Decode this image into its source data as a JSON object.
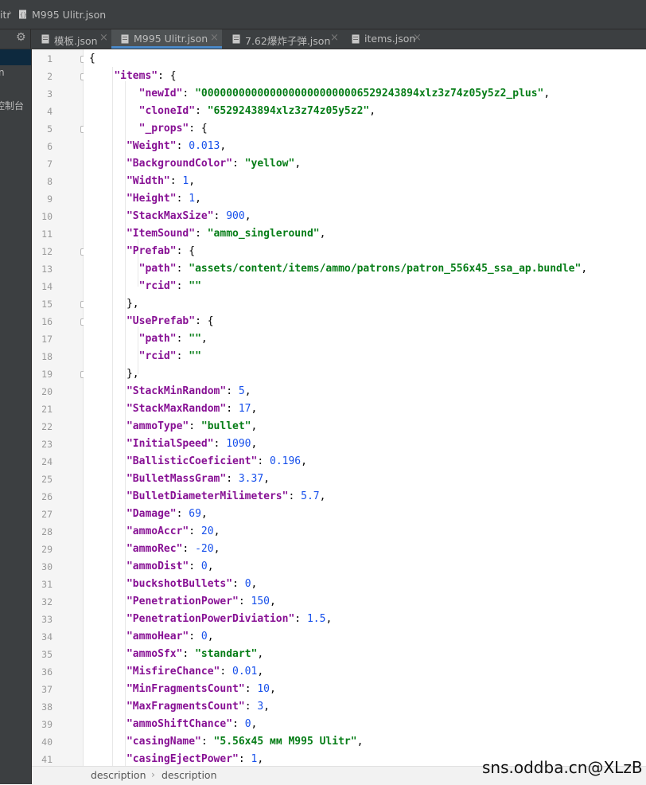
{
  "breadcrumb": {
    "project": "itr",
    "file": "M995 Ulitr.json"
  },
  "tabs": [
    {
      "label": "模板.json",
      "active": false
    },
    {
      "label": "M995 Ulitr.json",
      "active": true
    },
    {
      "label": "7.62爆炸子弹.json",
      "active": false
    },
    {
      "label": "items.json",
      "active": false
    }
  ],
  "side_panel": {
    "items": [
      "n",
      "控制台"
    ]
  },
  "editor": {
    "line_numbers": [
      "1",
      "2",
      "3",
      "4",
      "5",
      "6",
      "7",
      "8",
      "9",
      "10",
      "11",
      "12",
      "13",
      "14",
      "15",
      "16",
      "17",
      "18",
      "19",
      "20",
      "21",
      "22",
      "23",
      "24",
      "25",
      "26",
      "27",
      "28",
      "29",
      "30",
      "31",
      "32",
      "33",
      "34",
      "35",
      "36",
      "37",
      "38",
      "39",
      "40",
      "41"
    ],
    "lines": [
      "{",
      "    \"items\": {",
      "        \"newId\": \"00000000000000000000000006529243894xlz3z74z05y5z2_plus\",",
      "        \"cloneId\": \"6529243894xlz3z74z05y5z2\",",
      "        \"_props\": {",
      "      \"Weight\": 0.013,",
      "      \"BackgroundColor\": \"yellow\",",
      "      \"Width\": 1,",
      "      \"Height\": 1,",
      "      \"StackMaxSize\": 900,",
      "      \"ItemSound\": \"ammo_singleround\",",
      "      \"Prefab\": {",
      "        \"path\": \"assets/content/items/ammo/patrons/patron_556x45_ssa_ap.bundle\",",
      "        \"rcid\": \"\"",
      "      },",
      "      \"UsePrefab\": {",
      "        \"path\": \"\",",
      "        \"rcid\": \"\"",
      "      },",
      "      \"StackMinRandom\": 5,",
      "      \"StackMaxRandom\": 17,",
      "      \"ammoType\": \"bullet\",",
      "      \"InitialSpeed\": 1090,",
      "      \"BallisticCoeficient\": 0.196,",
      "      \"BulletMassGram\": 3.37,",
      "      \"BulletDiameterMilimeters\": 5.7,",
      "      \"Damage\": 69,",
      "      \"ammoAccr\": 20,",
      "      \"ammoRec\": -20,",
      "      \"ammoDist\": 0,",
      "      \"buckshotBullets\": 0,",
      "      \"PenetrationPower\": 150,",
      "      \"PenetrationPowerDiviation\": 1.5,",
      "      \"ammoHear\": 0,",
      "      \"ammoSfx\": \"standart\",",
      "      \"MisfireChance\": 0.01,",
      "      \"MinFragmentsCount\": 10,",
      "      \"MaxFragmentsCount\": 3,",
      "      \"ammoShiftChance\": 0,",
      "      \"casingName\": \"5.56x45 мм M995 Ulitr\",",
      "      \"casingEjectPower\": 1,"
    ]
  },
  "bottom_breadcrumb": [
    "description",
    "description"
  ],
  "watermark": "sns.oddba.cn@XLzB",
  "colors": {
    "key": "#871094",
    "string": "#067d17",
    "number": "#1750eb",
    "tab_accent": "#4a88c7"
  }
}
